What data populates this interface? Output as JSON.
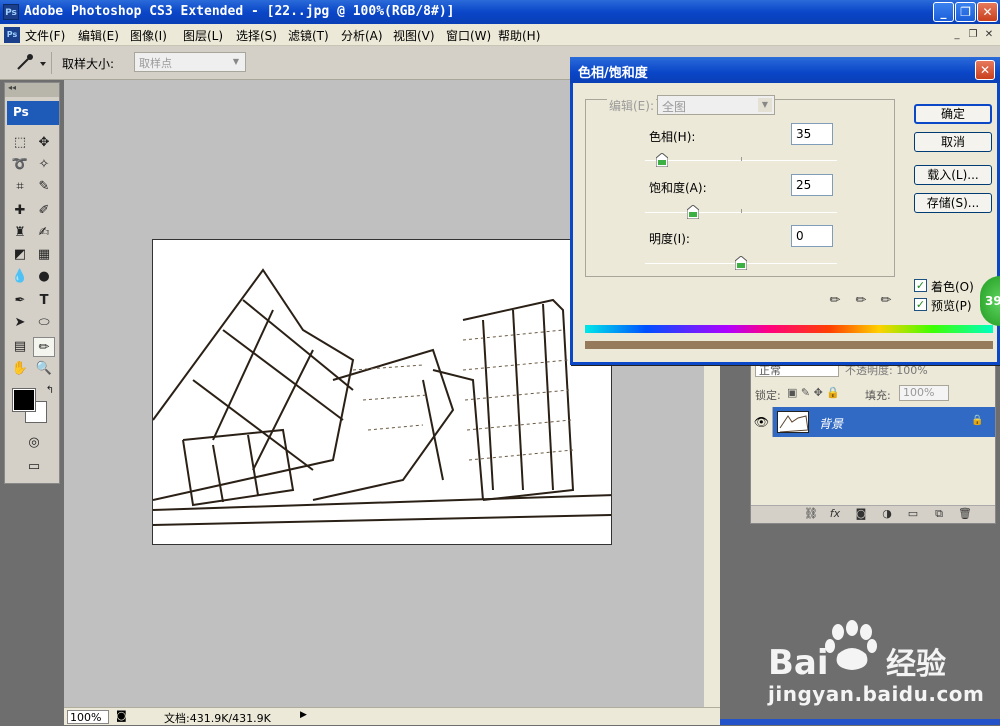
{
  "window": {
    "app_badge": "Ps",
    "title": "Adobe Photoshop CS3 Extended - [22..jpg @ 100%(RGB/8#)]",
    "controls": [
      "_",
      "❐",
      "✕"
    ]
  },
  "menubar": {
    "doc_badge": "Ps",
    "items": [
      "文件(F)",
      "编辑(E)",
      "图像(I)",
      "图层(L)",
      "选择(S)",
      "滤镜(T)",
      "分析(A)",
      "视图(V)",
      "窗口(W)",
      "帮助(H)"
    ],
    "mdi_controls": [
      "_",
      "❐",
      "✕"
    ]
  },
  "options": {
    "sample_size_label": "取样大小:",
    "sample_size_value": "取样点"
  },
  "toolbox": {
    "header": "◂◂",
    "logo": "Ps"
  },
  "statusbar": {
    "zoom": "100%",
    "doc_info": "文档:431.9K/431.9K"
  },
  "layers": {
    "blend_mode": "正常",
    "opacity_label": "不透明度: 100%",
    "lock_label": "锁定:",
    "fill_label": "填充:",
    "fill_value": "100%",
    "layer_name": "背景"
  },
  "dialog": {
    "title": "色相/饱和度",
    "edit_label": "编辑(E):",
    "edit_value": "全图",
    "hue_label": "色相(H):",
    "hue_value": "35",
    "hue_fraction": 0.09,
    "saturation_label": "饱和度(A):",
    "saturation_value": "25",
    "saturation_fraction": 0.25,
    "lightness_label": "明度(I):",
    "lightness_value": "0",
    "lightness_fraction": 0.5,
    "buttons": {
      "ok": "确定",
      "cancel": "取消",
      "load": "载入(L)...",
      "save": "存储(S)..."
    },
    "colorize_label": "着色(O)",
    "colorize_checked": true,
    "preview_label": "预览(P)",
    "preview_checked": true,
    "result_color": "#957b5c"
  },
  "badge_number": "39",
  "watermark": {
    "logo_text": "Bai 经验",
    "url": "jingyan.baidu.com"
  }
}
